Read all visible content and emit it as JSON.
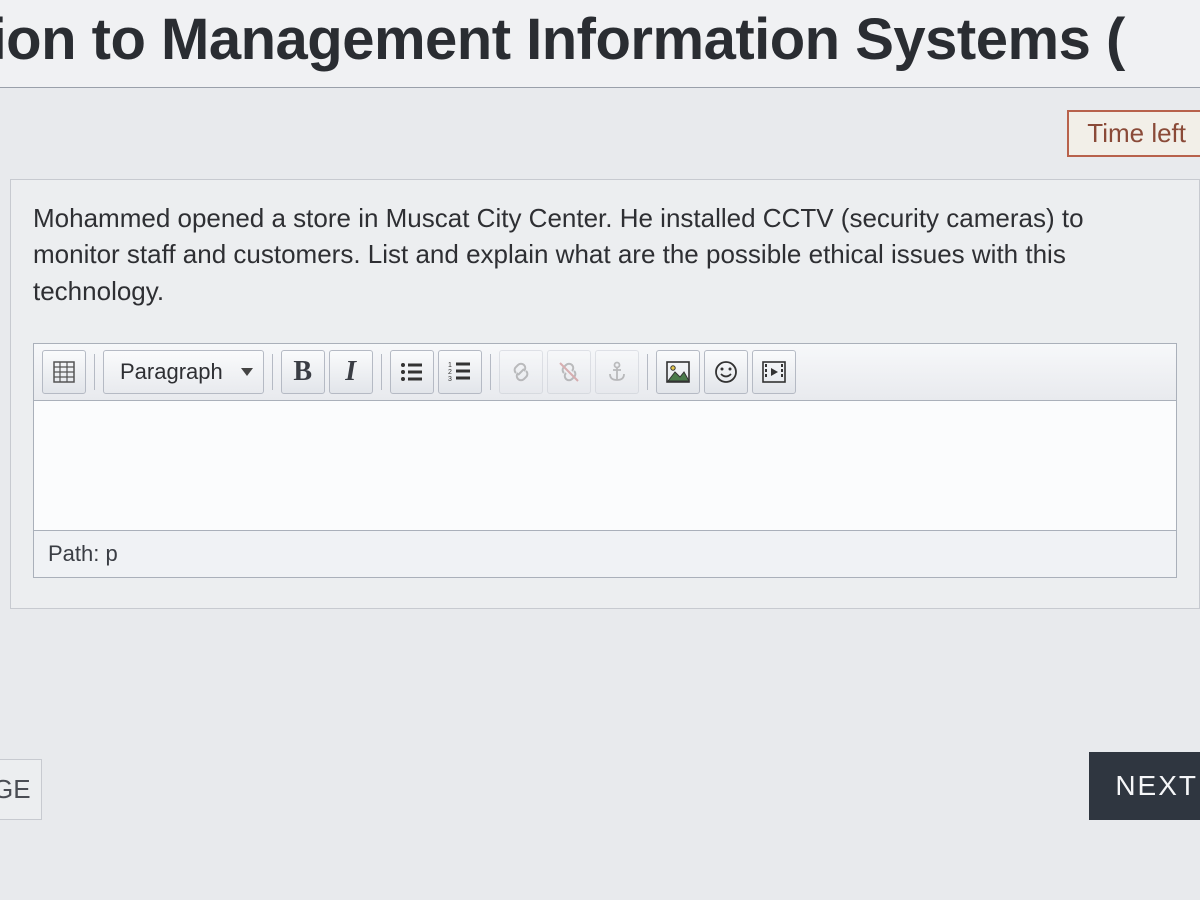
{
  "header": {
    "title": "ction to Management Information Systems ("
  },
  "timer": {
    "label": "Time left"
  },
  "question": {
    "text": "Mohammed opened a store in Muscat City Center. He installed CCTV (security cameras) to monitor staff and customers. List and explain what are the possible ethical issues with this technology."
  },
  "editor": {
    "format_selected": "Paragraph",
    "path_label": "Path: p",
    "content": ""
  },
  "nav": {
    "prev_label": "GE",
    "next_label": "NEXT"
  }
}
